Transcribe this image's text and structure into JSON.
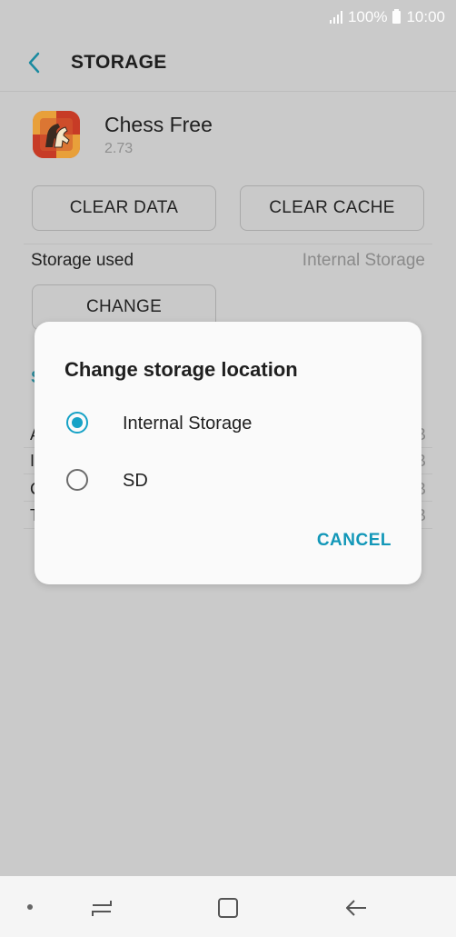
{
  "status_bar": {
    "battery_text": "100%",
    "time": "10:00"
  },
  "app_bar": {
    "title": "STORAGE",
    "back_icon": "chevron-left-icon"
  },
  "app": {
    "name": "Chess Free",
    "version": "2.73",
    "icon": "chess-app-icon"
  },
  "buttons": {
    "clear_data": "CLEAR DATA",
    "clear_cache": "CLEAR CACHE",
    "change": "CHANGE"
  },
  "storage": {
    "label": "Storage used",
    "value": "Internal Storage"
  },
  "background_rows": {
    "section_letter": "S",
    "row_letters": [
      "A",
      "I",
      "C",
      "T"
    ],
    "row_right": [
      "B",
      "B",
      "B",
      "B"
    ]
  },
  "dialog": {
    "title": "Change storage location",
    "options": [
      {
        "label": "Internal Storage",
        "selected": true
      },
      {
        "label": "SD",
        "selected": false
      }
    ],
    "cancel_label": "CANCEL"
  },
  "nav_bar": {
    "icons": [
      "dot-icon",
      "recents-icon",
      "home-icon",
      "back-icon"
    ]
  },
  "colors": {
    "accent": "#16a2c6",
    "dim_background": "#cacaca",
    "dialog_bg": "#fafafa"
  }
}
